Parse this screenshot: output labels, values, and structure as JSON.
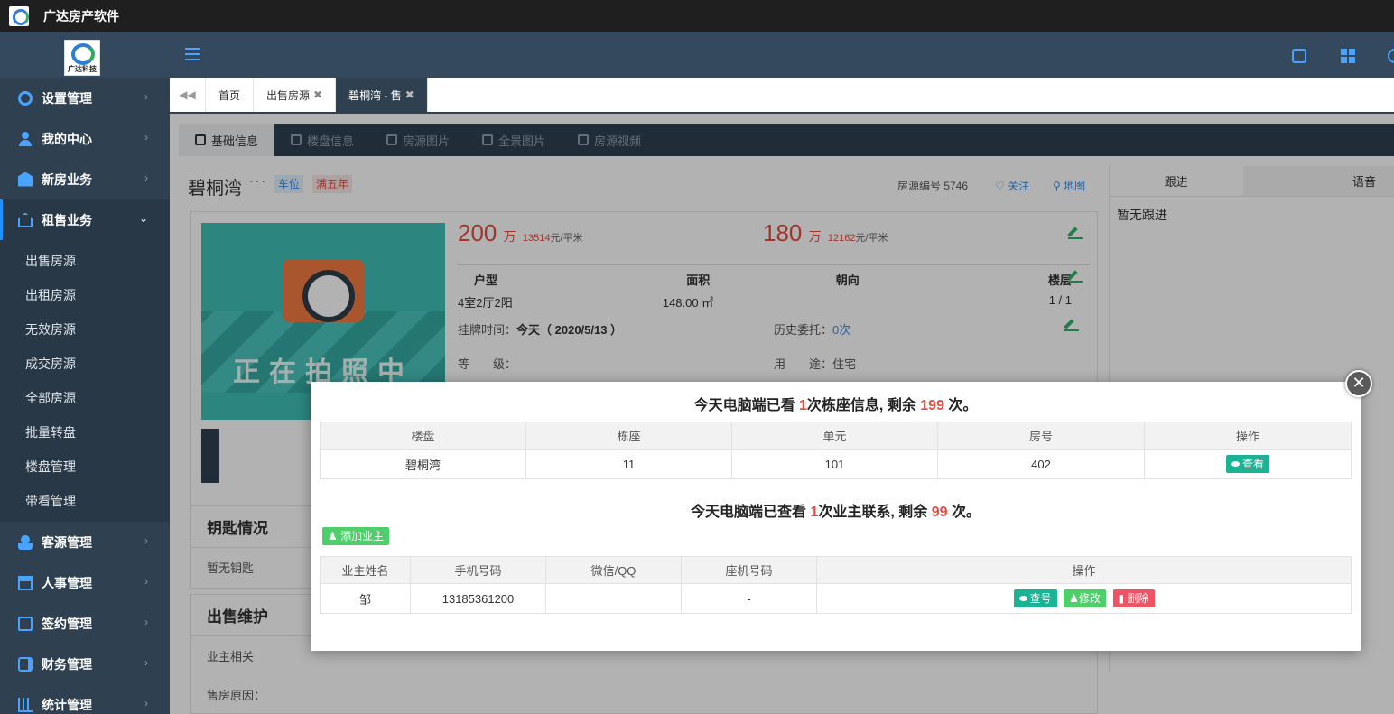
{
  "app": {
    "title": "广达房产软件",
    "brand_text": "广达科技"
  },
  "sidebar": {
    "items": [
      {
        "label": "设置管理",
        "icon": "gear-icon"
      },
      {
        "label": "我的中心",
        "icon": "person-icon"
      },
      {
        "label": "新房业务",
        "icon": "building-icon"
      },
      {
        "label": "租售业务",
        "icon": "home-icon",
        "expanded": true
      },
      {
        "label": "客源管理",
        "icon": "users-icon"
      },
      {
        "label": "人事管理",
        "icon": "org-icon"
      },
      {
        "label": "签约管理",
        "icon": "doc-icon"
      },
      {
        "label": "财务管理",
        "icon": "wallet-icon"
      },
      {
        "label": "统计管理",
        "icon": "chart-icon"
      }
    ],
    "submenu": [
      "出售房源",
      "出租房源",
      "无效房源",
      "成交房源",
      "全部房源",
      "批量转盘",
      "楼盘管理",
      "带看管理"
    ]
  },
  "tabs": [
    {
      "label": "首页"
    },
    {
      "label": "出售房源",
      "close": "✖"
    },
    {
      "label": "碧桐湾 - 售",
      "close": "✖",
      "active": true
    }
  ],
  "inner_tabs": [
    "基础信息",
    "楼盘信息",
    "房源图片",
    "全景图片",
    "房源视频"
  ],
  "house": {
    "name": "碧桐湾",
    "dots": "···",
    "tag_blue": "车位",
    "tag_red": "满五年",
    "house_no": "房源编号 5746",
    "follow": "关注",
    "map": "地图",
    "photo_text": "正在拍照中",
    "price_total": "200",
    "price_total_unit": "万",
    "price_unit_value": "13514",
    "price_unit_suffix": "元/平米",
    "base_total": "180",
    "base_total_unit": "万",
    "base_unit_value": "12162",
    "base_unit_suffix": "元/平米",
    "spec_headers": [
      "户型",
      "面积",
      "朝向",
      "楼层"
    ],
    "spec_values": [
      "4室2厅2阳",
      "148.00 ㎡",
      "",
      "1 / 1"
    ],
    "listed_label": "挂牌时间：",
    "listed_value": "今天（ 2020/5/13 ）",
    "history_label": "历史委托：",
    "history_value": "0次",
    "level_label": "等　　级：",
    "usage_label": "用　　途：",
    "usage_value": "住宅"
  },
  "sections": {
    "keys_title": "钥匙情况",
    "keys_empty": "暂无钥匙",
    "maintain_title": "出售维护",
    "owner_related": "业主相关",
    "sell_reason": "售房原因："
  },
  "right_panel": {
    "tab_follow": "跟进",
    "tab_voice": "语音",
    "empty": "暂无跟进"
  },
  "modal": {
    "close": "✕",
    "notice1": {
      "prefix": "今天电脑端已看 ",
      "used": "1",
      "middle": "次栋座信息, 剩余 ",
      "remain": "199",
      "suffix": " 次。"
    },
    "table1": {
      "headers": [
        "楼盘",
        "栋座",
        "单元",
        "房号",
        "操作"
      ],
      "row": [
        "碧桐湾",
        "11",
        "101",
        "402"
      ],
      "action": "查看"
    },
    "notice2": {
      "prefix": "今天电脑端已查看 ",
      "used": "1",
      "middle": "次业主联系, 剩余 ",
      "remain": "99",
      "suffix": " 次。"
    },
    "add_owner": "添加业主",
    "table2": {
      "headers": [
        "业主姓名",
        "手机号码",
        "微信/QQ",
        "座机号码",
        "操作"
      ],
      "row": [
        "邹",
        "13185361200",
        "",
        "-"
      ],
      "actions": [
        "查号",
        "修改",
        "删除"
      ]
    }
  }
}
